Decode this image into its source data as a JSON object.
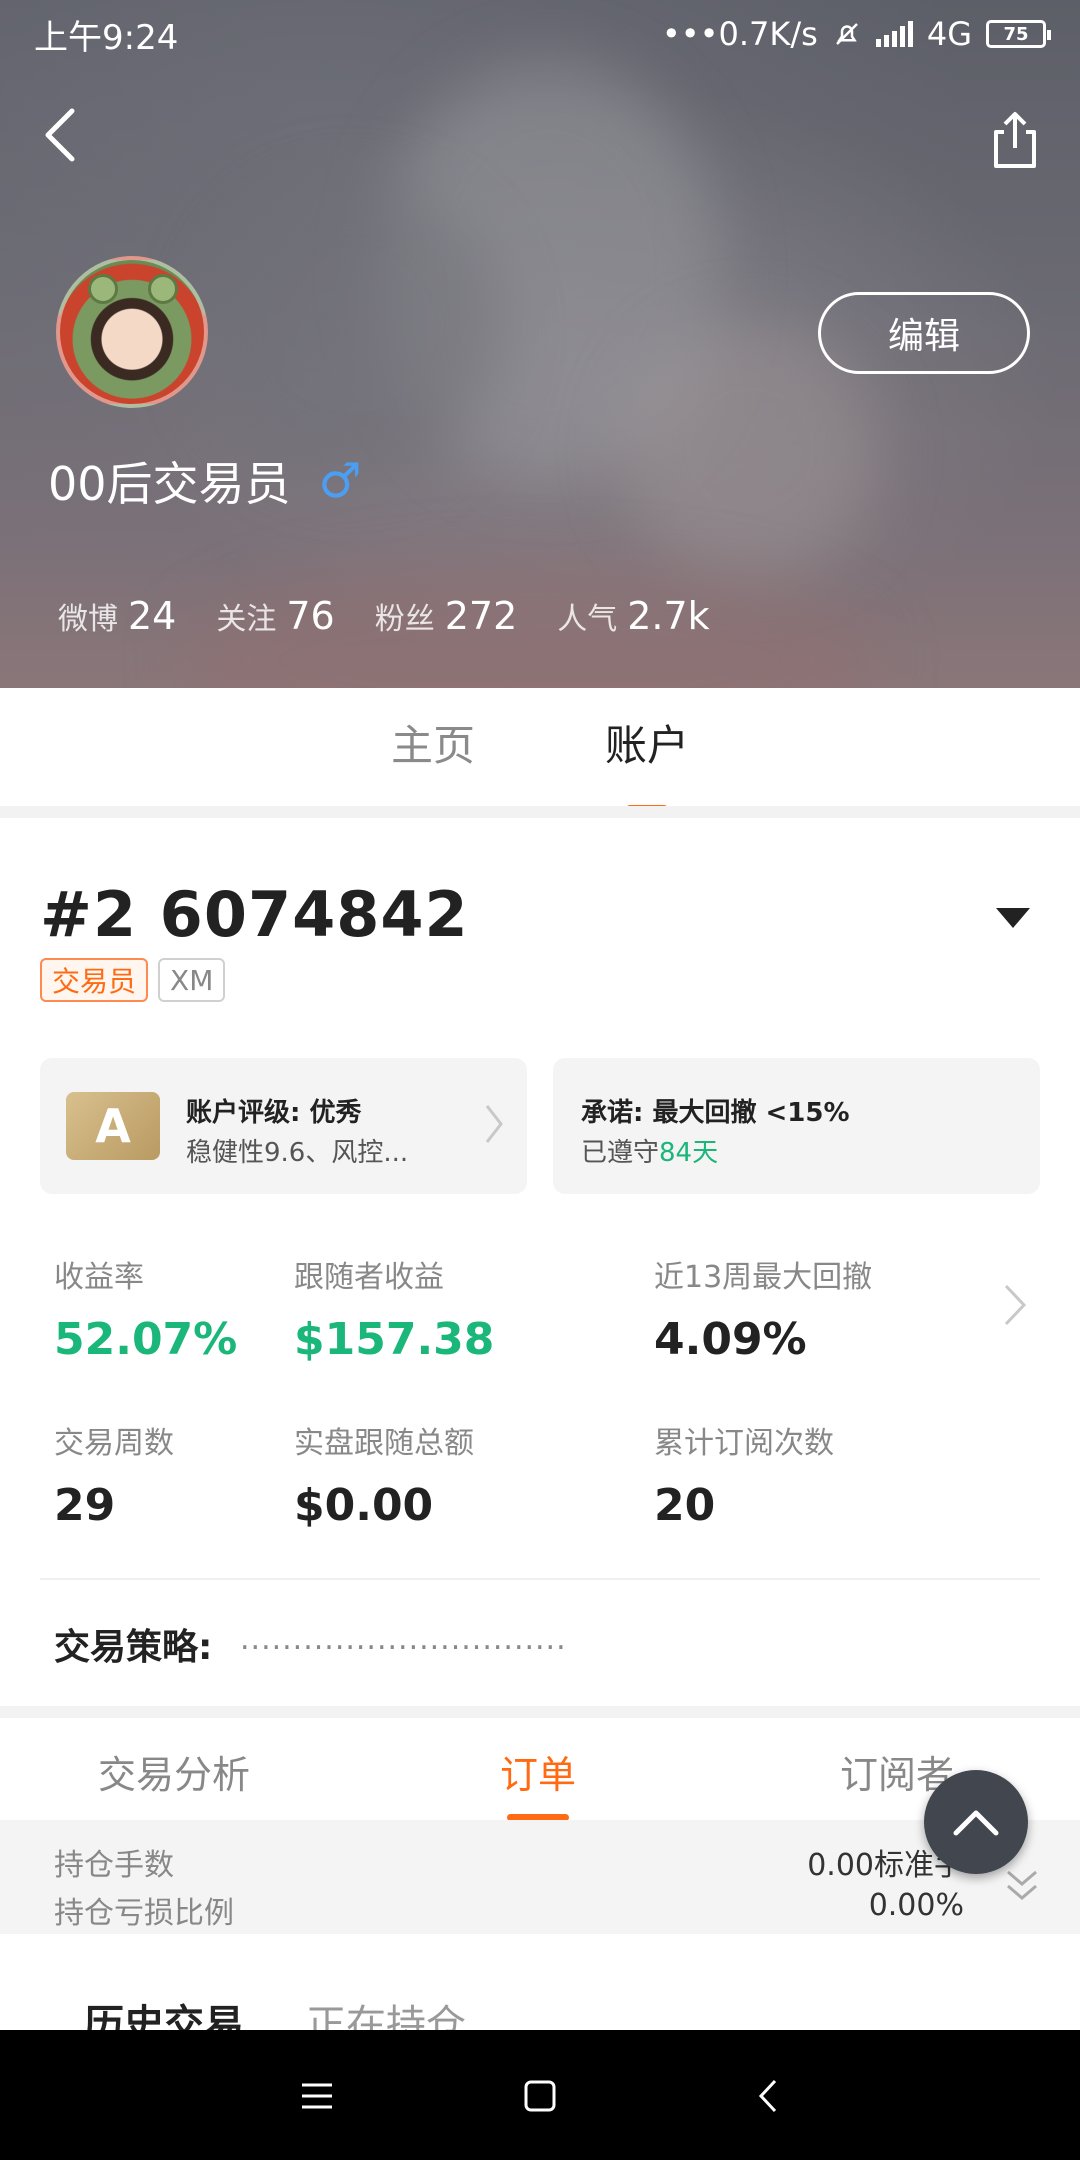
{
  "status_bar": {
    "time": "上午9:24",
    "net_speed": "•••0.7K/s",
    "network": "4G",
    "battery": "75"
  },
  "header": {
    "username": "00后交易员",
    "gender_symbol": "♂",
    "edit_label": "编辑",
    "stats": [
      {
        "label": "微博",
        "value": "24"
      },
      {
        "label": "关注",
        "value": "76"
      },
      {
        "label": "粉丝",
        "value": "272"
      },
      {
        "label": "人气",
        "value": "2.7k"
      }
    ]
  },
  "top_tabs": [
    {
      "label": "主页",
      "active": false
    },
    {
      "label": "账户",
      "active": true
    }
  ],
  "account": {
    "number": "#2 6074842",
    "tags": [
      "交易员",
      "XM"
    ],
    "rating_card": {
      "badge": "A",
      "title": "账户评级: 优秀",
      "subtitle": "稳健性9.6、风控..."
    },
    "promise_card": {
      "title": "承诺: 最大回撤 <15%",
      "subtitle_prefix": "已遵守",
      "subtitle_days": "84天"
    },
    "metrics": [
      {
        "label": "收益率",
        "value": "52.07%",
        "green": true
      },
      {
        "label": "跟随者收益",
        "value": "$157.38",
        "green": true
      },
      {
        "label": "近13周最大回撤",
        "value": "4.09%",
        "green": false
      },
      {
        "label": "交易周数",
        "value": "29",
        "green": false
      },
      {
        "label": "实盘跟随总额",
        "value": "$0.00",
        "green": false
      },
      {
        "label": "累计订阅次数",
        "value": "20",
        "green": false
      }
    ],
    "strategy_label": "交易策略:",
    "strategy_value": "..............................."
  },
  "sub_tabs": [
    {
      "label": "交易分析",
      "active": false
    },
    {
      "label": "订单",
      "active": true
    },
    {
      "label": "订阅者",
      "active": false
    }
  ],
  "positions": [
    {
      "label": "持仓手数",
      "value": "0.00标准手"
    },
    {
      "label": "持仓亏损比例",
      "value": "0.00%"
    }
  ],
  "history_tabs": [
    {
      "label": "历史交易",
      "active": true
    },
    {
      "label": "正在持仓",
      "active": false
    }
  ],
  "colors": {
    "accent": "#ff6a13",
    "positive": "#1ab67a",
    "male": "#4a9ff5"
  },
  "icons": [
    "back-icon",
    "share-icon",
    "chevron-right-icon",
    "dropdown-arrow-icon",
    "scroll-top-icon",
    "expand-icon",
    "menu-icon",
    "home-icon",
    "back-nav-icon"
  ]
}
